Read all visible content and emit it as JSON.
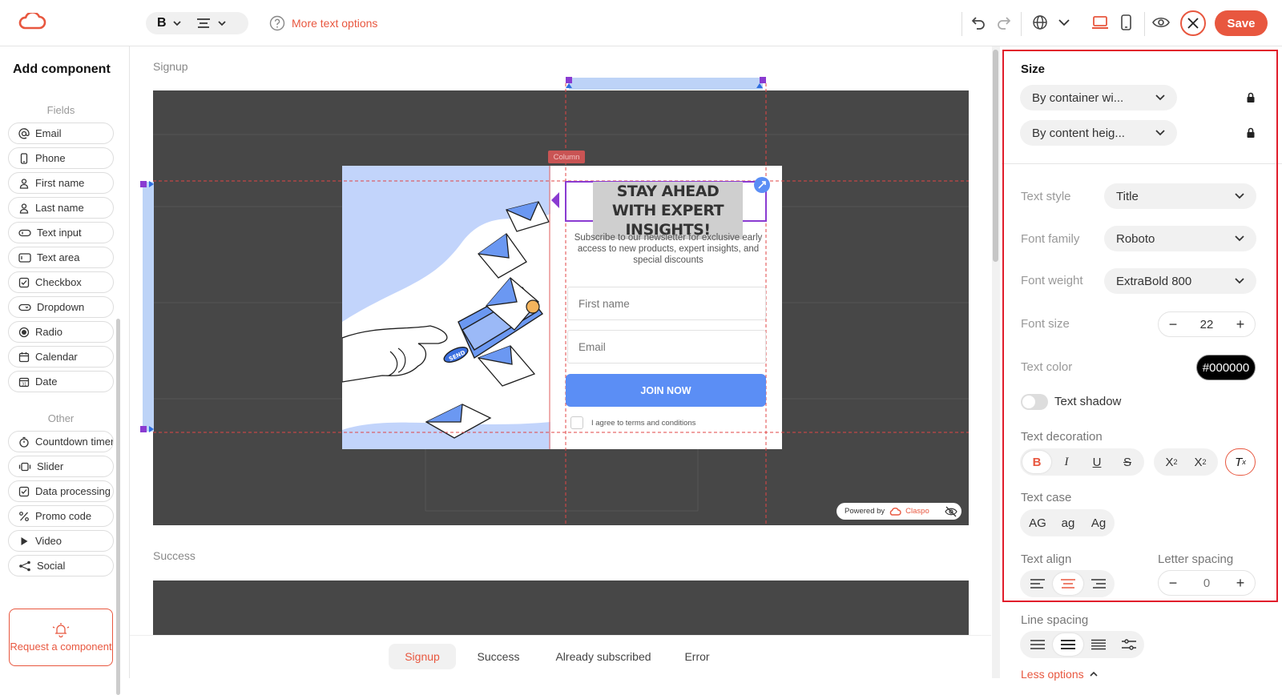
{
  "toolbar": {
    "bold_label": "B",
    "more_text_options": "More text options",
    "save_label": "Save"
  },
  "left_panel": {
    "title": "Add component",
    "fields_label": "Fields",
    "fields": [
      {
        "label": "Email",
        "icon": "at-icon"
      },
      {
        "label": "Phone",
        "icon": "phone-icon"
      },
      {
        "label": "First name",
        "icon": "user-icon"
      },
      {
        "label": "Last name",
        "icon": "user-icon"
      },
      {
        "label": "Text input",
        "icon": "text-input-icon"
      },
      {
        "label": "Text area",
        "icon": "text-area-icon"
      },
      {
        "label": "Checkbox",
        "icon": "checkbox-icon"
      },
      {
        "label": "Dropdown",
        "icon": "dropdown-icon"
      },
      {
        "label": "Radio",
        "icon": "radio-icon"
      },
      {
        "label": "Calendar",
        "icon": "calendar-icon"
      },
      {
        "label": "Date",
        "icon": "date-icon"
      }
    ],
    "other_label": "Other",
    "other": [
      {
        "label": "Countdown timer",
        "icon": "timer-icon"
      },
      {
        "label": "Slider",
        "icon": "slider-icon"
      },
      {
        "label": "Data processing",
        "icon": "checkbox-icon"
      },
      {
        "label": "Promo code",
        "icon": "percent-icon"
      },
      {
        "label": "Video",
        "icon": "play-icon"
      },
      {
        "label": "Social",
        "icon": "share-icon"
      }
    ],
    "request_component": "Request a component"
  },
  "canvas": {
    "signup_label": "Signup",
    "success_label": "Success",
    "column_tag": "Column",
    "popup": {
      "title": "STAY AHEAD WITH EXPERT INSIGHTS!",
      "subtitle": "Subscribe to our newsletter for exclusive early access to new products, expert insights, and special discounts",
      "first_name_placeholder": "First name",
      "email_placeholder": "Email",
      "join_button": "JOIN NOW",
      "agree_text": "I agree to terms and conditions",
      "send_label": "SEND"
    },
    "powered_by": "Powered by",
    "brand": "Claspo"
  },
  "bottom_tabs": [
    {
      "label": "Signup",
      "active": true
    },
    {
      "label": "Success",
      "active": false
    },
    {
      "label": "Already subscribed",
      "active": false
    },
    {
      "label": "Error",
      "active": false
    }
  ],
  "right_panel": {
    "size_title": "Size",
    "width_mode": "By container wi...",
    "height_mode": "By content heig...",
    "text_style_label": "Text style",
    "text_style_value": "Title",
    "font_family_label": "Font family",
    "font_family_value": "Roboto",
    "font_weight_label": "Font weight",
    "font_weight_value": "ExtraBold 800",
    "font_size_label": "Font size",
    "font_size_value": "22",
    "text_color_label": "Text color",
    "text_color_value": "#000000",
    "text_shadow_label": "Text shadow",
    "text_decoration_label": "Text decoration",
    "text_case_label": "Text case",
    "case_options": [
      "AG",
      "ag",
      "Ag"
    ],
    "text_align_label": "Text align",
    "letter_spacing_label": "Letter spacing",
    "letter_spacing_value": "0",
    "line_spacing_label": "Line spacing",
    "less_options": "Less options"
  },
  "colors": {
    "accent": "#e8573f",
    "canvas_dark": "#474747",
    "popup_blue": "#5b8ef5",
    "highlight_red": "#e11d2b"
  }
}
